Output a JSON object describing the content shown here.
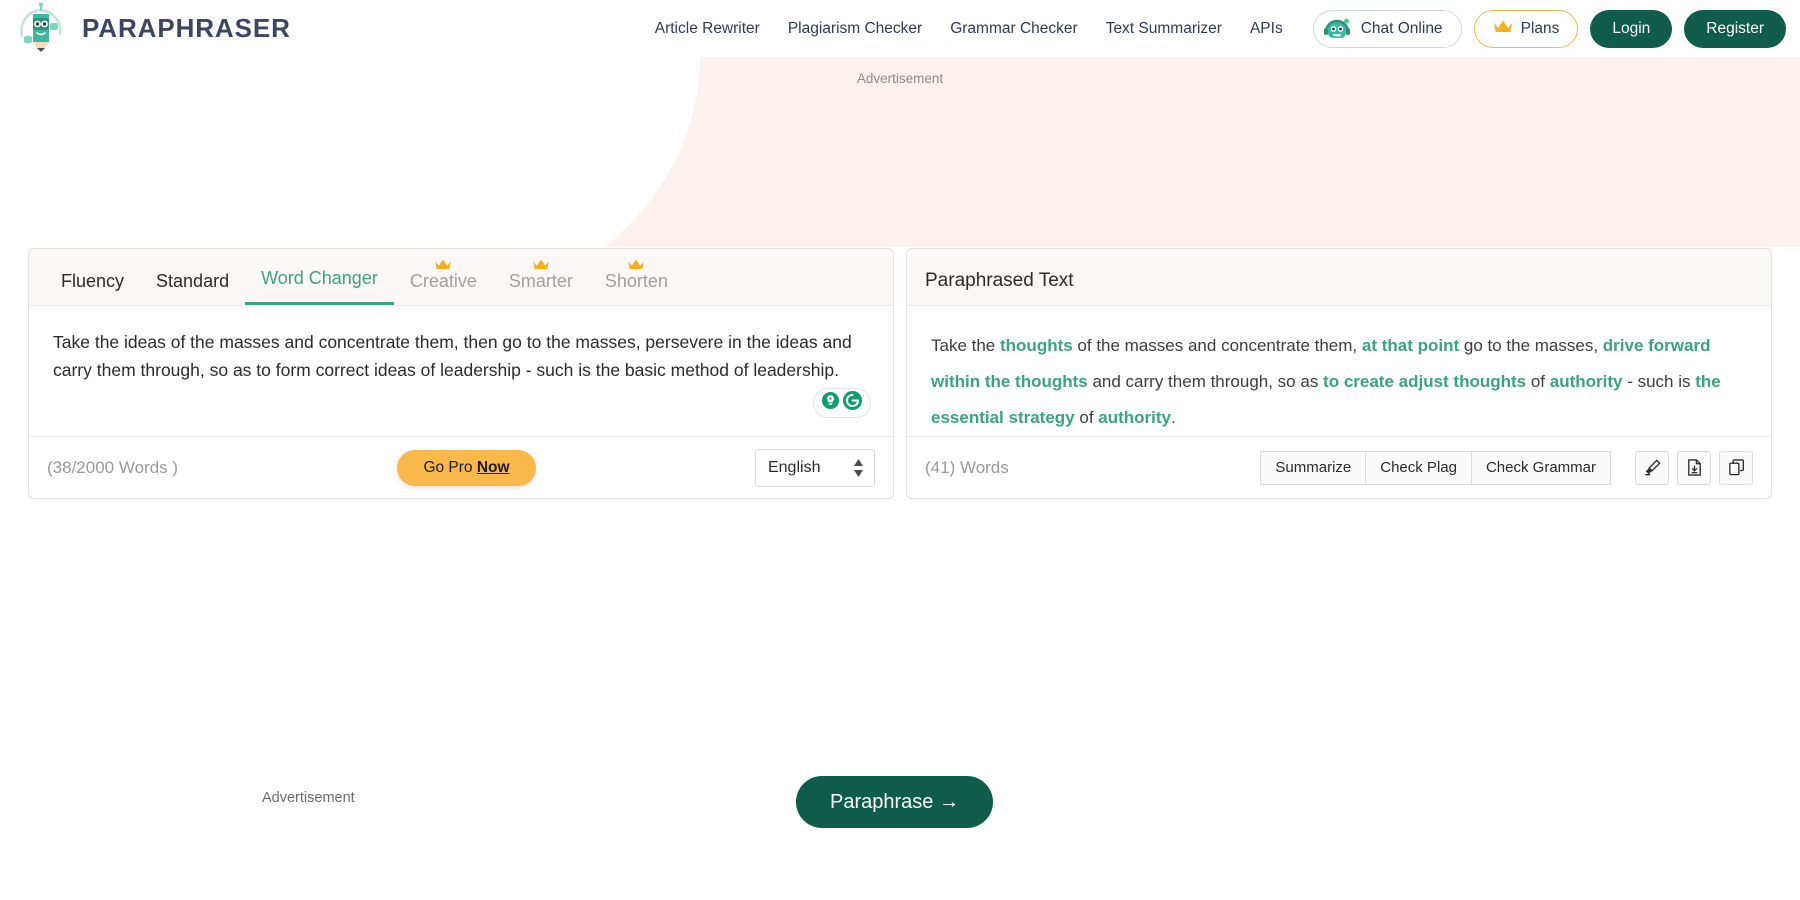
{
  "header": {
    "brand": "PARAPHRASER",
    "logo_icon": "robot-pencil-logo",
    "nav": [
      {
        "label": "Article Rewriter",
        "name": "nav-article-rewriter"
      },
      {
        "label": "Plagiarism Checker",
        "name": "nav-plagiarism-checker"
      },
      {
        "label": "Grammar Checker",
        "name": "nav-grammar-checker"
      },
      {
        "label": "Text Summarizer",
        "name": "nav-text-summarizer"
      },
      {
        "label": "APIs",
        "name": "nav-apis"
      }
    ],
    "chat_label": "Chat Online",
    "chat_icon": "robot-headset-icon",
    "plans_label": "Plans",
    "plans_icon": "crown-icon",
    "login_label": "Login",
    "register_label": "Register"
  },
  "ads": {
    "top_label": "Advertisement",
    "bottom_label": "Advertisement"
  },
  "colors": {
    "accent_green": "#3aa37f",
    "dark_green": "#0f5c4a",
    "gold": "#f8b94a",
    "nav_text": "#2e3a59",
    "peach_bg": "#fdf1ee"
  },
  "editor": {
    "tabs": [
      {
        "label": "Fluency",
        "active": false,
        "pro": false
      },
      {
        "label": "Standard",
        "active": false,
        "pro": false
      },
      {
        "label": "Word Changer",
        "active": true,
        "pro": false
      },
      {
        "label": "Creative",
        "active": false,
        "pro": true
      },
      {
        "label": "Smarter",
        "active": false,
        "pro": true
      },
      {
        "label": "Shorten",
        "active": false,
        "pro": true
      }
    ],
    "source_text": "Take the ideas of the masses and concentrate them, then go to the masses, persevere in the ideas and carry them through, so as to form correct ideas of leadership - such is the basic method of leadership.",
    "word_count": "(38/2000 Words )",
    "go_pro_prefix": "Go Pro ",
    "go_pro_emphasis": "Now",
    "language": "English",
    "grammarly_icons": [
      "lightbulb-icon",
      "grammarly-refresh-icon"
    ]
  },
  "output": {
    "title": "Paraphrased Text",
    "word_count": "(41) Words",
    "segments": [
      {
        "text": "Take the ",
        "hl": false
      },
      {
        "text": "thoughts",
        "hl": true
      },
      {
        "text": " of the masses and concentrate them, ",
        "hl": false
      },
      {
        "text": "at that point",
        "hl": true
      },
      {
        "text": " go to the masses, ",
        "hl": false
      },
      {
        "text": "drive forward within the thoughts",
        "hl": true
      },
      {
        "text": " and carry them through, so as ",
        "hl": false
      },
      {
        "text": "to create adjust thoughts",
        "hl": true
      },
      {
        "text": " of ",
        "hl": false
      },
      {
        "text": "authority",
        "hl": true
      },
      {
        "text": " - such is ",
        "hl": false
      },
      {
        "text": "the essential strategy",
        "hl": true
      },
      {
        "text": " of ",
        "hl": false
      },
      {
        "text": "authority",
        "hl": true
      },
      {
        "text": ".",
        "hl": false
      }
    ],
    "actions": [
      {
        "label": "Summarize",
        "name": "summarize-button"
      },
      {
        "label": "Check Plag",
        "name": "check-plag-button"
      },
      {
        "label": "Check Grammar",
        "name": "check-grammar-button"
      }
    ],
    "icons": [
      {
        "name": "highlighter-icon"
      },
      {
        "name": "download-document-icon"
      },
      {
        "name": "copy-icon"
      }
    ]
  },
  "footer": {
    "paraphrase_label": "Paraphrase  →"
  }
}
